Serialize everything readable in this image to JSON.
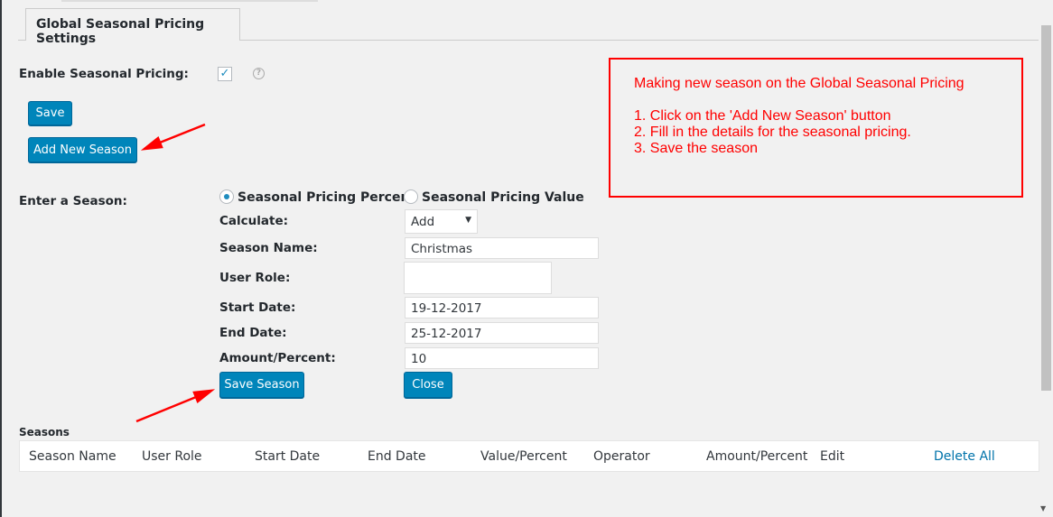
{
  "tab": {
    "label": "Global Seasonal Pricing Settings"
  },
  "enable": {
    "label": "Enable Seasonal Pricing:",
    "checked": true,
    "help_icon": "question-circle-icon"
  },
  "buttons": {
    "save": "Save",
    "add_new_season": "Add New Season",
    "save_season": "Save Season",
    "close": "Close"
  },
  "season_form": {
    "label": "Enter a Season:",
    "radio_percent": "Seasonal Pricing Percent",
    "radio_value": "Seasonal Pricing Value",
    "selected": "percent",
    "calculate_label": "Calculate:",
    "calculate_value": "Add",
    "season_name_label": "Season Name:",
    "season_name_value": "Christmas",
    "user_role_label": "User Role:",
    "user_role_value": "",
    "start_date_label": "Start Date:",
    "start_date_value": "19-12-2017",
    "end_date_label": "End Date:",
    "end_date_value": "25-12-2017",
    "amount_label": "Amount/Percent:",
    "amount_value": "10"
  },
  "seasons": {
    "title": "Seasons",
    "columns": [
      "Season Name",
      "User Role",
      "Start Date",
      "End Date",
      "Value/Percent",
      "Operator",
      "Amount/Percent",
      "Edit"
    ],
    "delete_all": "Delete All"
  },
  "annotation": {
    "title": "Making new season on the Global Seasonal Pricing",
    "steps": [
      "1. Click on the 'Add New Season' button",
      "2. Fill in the details for the seasonal pricing.",
      "3. Save the season"
    ],
    "color": "#ff0000"
  },
  "colors": {
    "accent": "#0085ba",
    "link": "#0073aa",
    "background": "#f1f1f1"
  }
}
